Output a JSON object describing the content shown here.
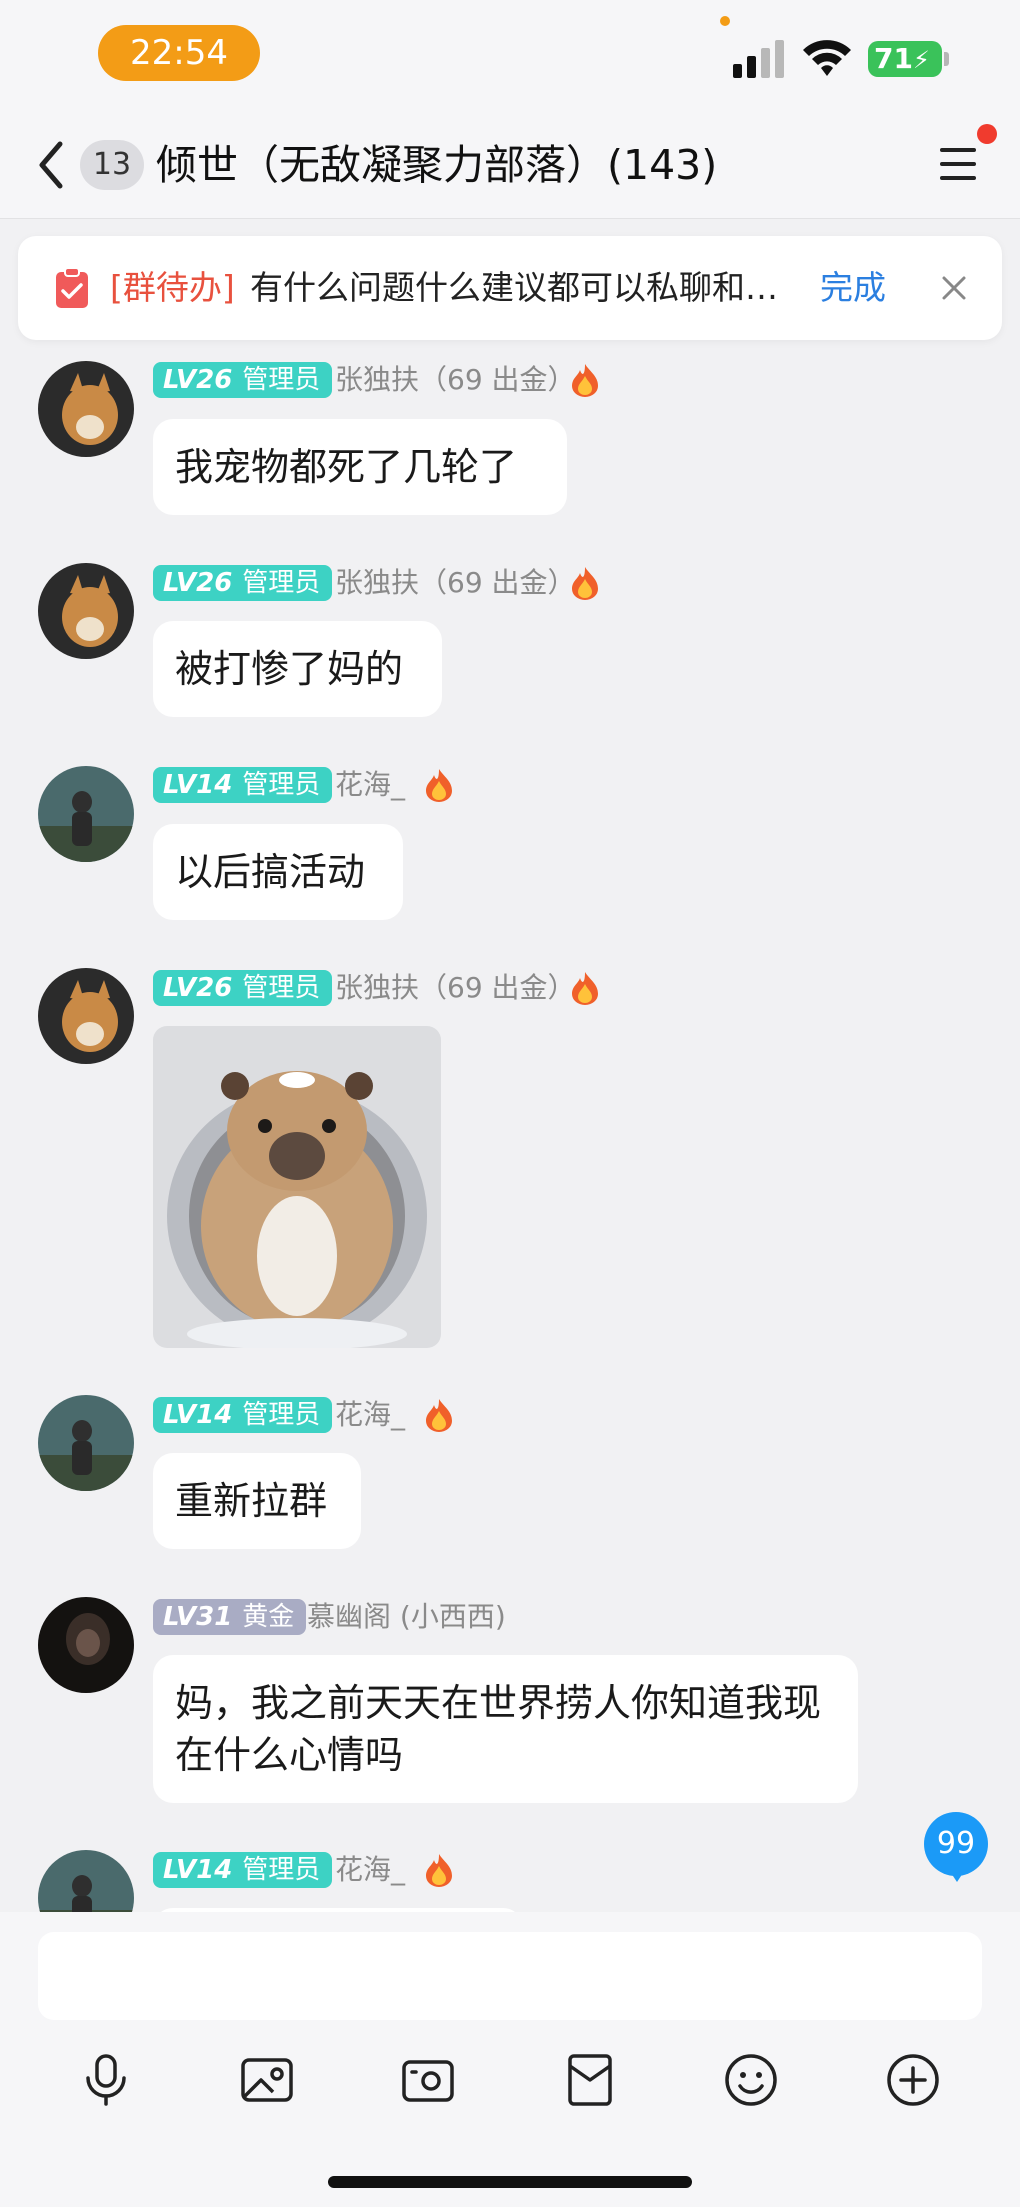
{
  "status_bar": {
    "time": "22:54",
    "battery": "71"
  },
  "header": {
    "unread_count": "13",
    "title": "倾世（无敌凝聚力部落）(143)"
  },
  "todo": {
    "tag": "[群待办]",
    "text": "有什么问题什么建议都可以私聊和…",
    "done": "完成"
  },
  "messages": [
    {
      "level": "LV26",
      "role": "管理员",
      "sender": "张独扶（69 出金）",
      "text": "我宠物都死了几轮了"
    },
    {
      "level": "LV26",
      "role": "管理员",
      "sender": "张独扶（69 出金）",
      "text": "被打惨了妈的"
    },
    {
      "level": "LV14",
      "role": "管理员",
      "sender": "花海_",
      "text": "以后搞活动"
    },
    {
      "level": "LV26",
      "role": "管理员",
      "sender": "张独扶（69 出金）",
      "text": ""
    },
    {
      "level": "LV14",
      "role": "管理员",
      "sender": "花海_",
      "text": "重新拉群"
    },
    {
      "level": "LV31",
      "role": "黄金",
      "sender": "慕幽阁 (小西西)",
      "text": "妈，我之前天天在世界捞人你知道我现在什么心情吗"
    },
    {
      "level": "LV14",
      "role": "管理员",
      "sender": "花海_",
      "text": ""
    }
  ],
  "floating_badge": "99",
  "icons": [
    "back-icon",
    "menu-icon",
    "todo-icon",
    "close-icon",
    "flame-icon",
    "microphone-icon",
    "image-icon",
    "camera-icon",
    "red-packet-icon",
    "emoji-icon",
    "plus-icon"
  ],
  "colors": {
    "accent_orange": "#f39c16",
    "teal_badge": "#3dd2c4",
    "gold_badge": "#a9acc4",
    "link_blue": "#2b7fe0",
    "todo_red": "#e8513e",
    "badge_blue": "#1b9af7"
  }
}
